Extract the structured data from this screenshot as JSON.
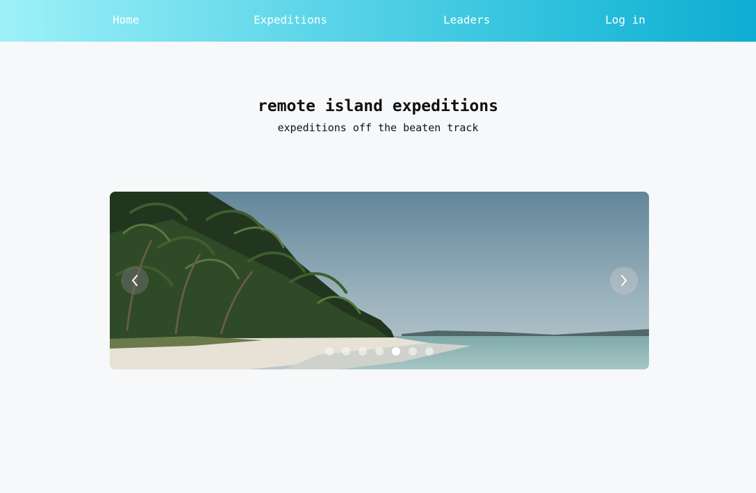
{
  "nav": {
    "home": "Home",
    "expeditions": "Expeditions",
    "leaders": "Leaders",
    "login": "Log in"
  },
  "hero": {
    "title": "remote island expeditions",
    "subtitle": "expeditions off the beaten track"
  },
  "carousel": {
    "slide_count": 7,
    "active_index": 4,
    "prev_icon": "chevron-left-icon",
    "next_icon": "chevron-right-icon"
  },
  "colors": {
    "nav_gradient_start": "#9ef1f8",
    "nav_gradient_end": "#0eadd1",
    "background": "#f6f8fa"
  }
}
